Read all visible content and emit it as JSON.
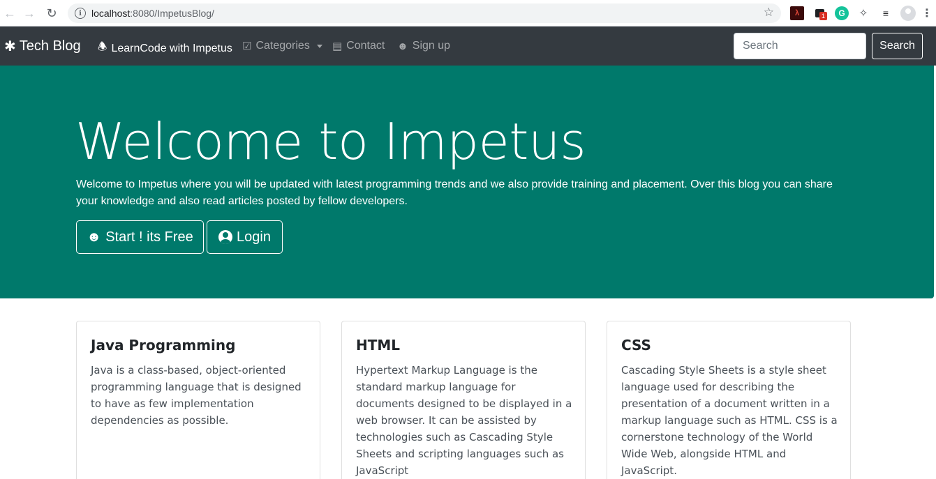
{
  "browser": {
    "url_host": "localhost",
    "url_path": ":8080/ImpetusBlog/"
  },
  "navbar": {
    "brand": "Tech Blog",
    "items": [
      {
        "label": "LearnCode with Impetus",
        "icon": "bell-icon"
      },
      {
        "label": "Categories",
        "icon": "check-square-icon"
      },
      {
        "label": "Contact",
        "icon": "address-card-icon"
      },
      {
        "label": "Sign up",
        "icon": "user-plus-icon"
      }
    ],
    "search_placeholder": "Search",
    "search_button": "Search"
  },
  "hero": {
    "title": "Welcome to Impetus",
    "text": "Welcome to Impetus where you will be updated with latest programming trends and we also provide training and placement. Over this blog you can share your knowledge and also read articles posted by fellow developers.",
    "start_button": "Start ! its Free",
    "login_button": "Login",
    "background": "#00796b"
  },
  "cards": [
    {
      "title": "Java Programming",
      "text": "Java is a class-based, object-oriented programming language that is designed to have as few implementation dependencies as possible."
    },
    {
      "title": "HTML",
      "text": "Hypertext Markup Language is the standard markup language for documents designed to be displayed in a web browser. It can be assisted by technologies such as Cascading Style Sheets and scripting languages such as JavaScript"
    },
    {
      "title": "CSS",
      "text": "Cascading Style Sheets is a style sheet language used for describing the presentation of a document written in a markup language such as HTML. CSS is a cornerstone technology of the World Wide Web, alongside HTML and JavaScript."
    }
  ],
  "colors": {
    "navbar_bg": "#343a40",
    "hero_bg": "#00796b"
  }
}
